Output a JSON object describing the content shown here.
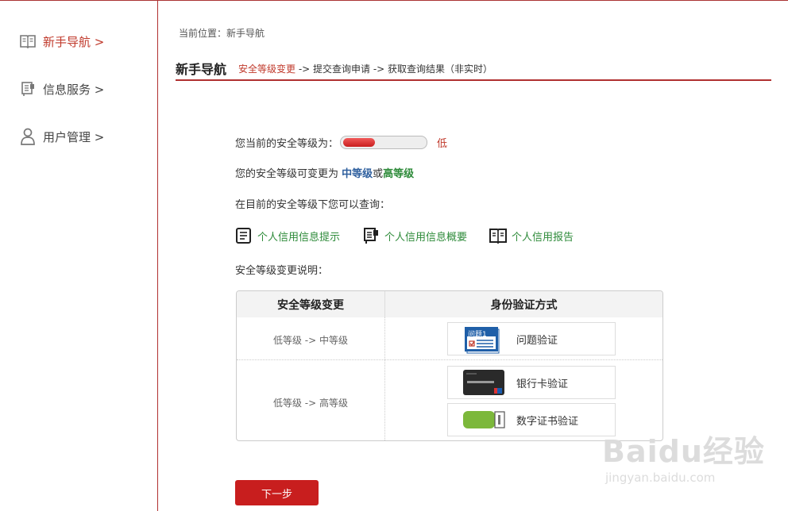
{
  "sidebar": {
    "items": [
      {
        "label": "新手导航 >",
        "icon": "book-icon"
      },
      {
        "label": "信息服务 >",
        "icon": "document-icon"
      },
      {
        "label": "用户管理 >",
        "icon": "user-icon"
      }
    ]
  },
  "breadcrumb": "当前位置：新手导航",
  "header": {
    "title": "新手导航",
    "steps": {
      "current": "安全等级变更",
      "rest": " -> 提交查询申请 -> 获取查询结果（非实时）"
    }
  },
  "security": {
    "label": "您当前的安全等级为：",
    "level_text": "低",
    "meter_fraction": 0.4,
    "changeable_prefix": "您的安全等级可变更为 ",
    "mid": "中等级",
    "or": "或",
    "high": "高等级",
    "query_text": "在目前的安全等级下您可以查询："
  },
  "links": [
    {
      "label": "个人信用信息提示",
      "icon": "note-icon"
    },
    {
      "label": "个人信用信息概要",
      "icon": "document-icon"
    },
    {
      "label": "个人信用报告",
      "icon": "book-icon"
    }
  ],
  "explain_title": "安全等级变更说明：",
  "table": {
    "headers": [
      "安全等级变更",
      "身份验证方式"
    ],
    "rows": [
      {
        "change": "低等级 -> 中等级",
        "methods": [
          "问题验证"
        ]
      },
      {
        "change": "低等级 -> 高等级",
        "methods": [
          "银行卡验证",
          "数字证书验证"
        ]
      }
    ],
    "question_card_text": "问题1"
  },
  "next_button": "下一步",
  "watermark": {
    "brand": "Baidu经验",
    "url": "jingyan.baidu.com"
  },
  "colors": {
    "accent": "#c0392b",
    "green": "#2e8b3a",
    "blue": "#2e5f9e"
  }
}
